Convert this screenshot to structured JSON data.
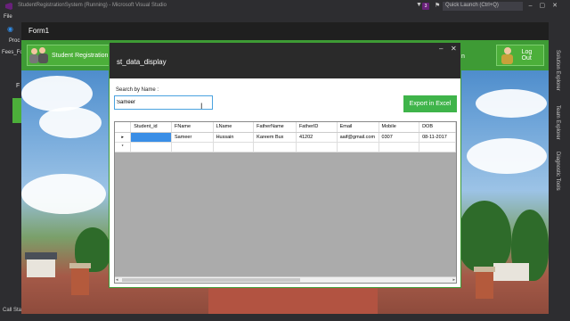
{
  "vs": {
    "title": "StudentRegistrationSystem (Running) - Microsoft Visual Studio",
    "notification_count": "3",
    "quick_launch": "Quick Launch (Ctrl+Q)",
    "menu_file": "File",
    "proc_label": "Proc",
    "fees_tab": "Fees_Fo",
    "side_letter": "F",
    "call_stack": "Call Sta",
    "right_tabs": [
      "Solution Explorer",
      "Team Explorer",
      "Diagnostic Tools"
    ]
  },
  "form1": {
    "title": "Form1",
    "student_registration_label": "Student Registration",
    "logout_label": "Log Out"
  },
  "dialog": {
    "title": "st_data_display",
    "partial_right_text": "n",
    "search_label": "Search by Name :",
    "search_value": "Sameer",
    "export_label": "Export in Excel",
    "grid": {
      "columns": [
        "Student_id",
        "FName",
        "LName",
        "FatherName",
        "FatherID",
        "Email",
        "Mobile",
        "DOB"
      ],
      "rows": [
        [
          "",
          "Sameer",
          "Hussain",
          "Kareem Bux",
          "41202",
          "aaif@gmail.com",
          "0307",
          "08-11-2017"
        ]
      ],
      "new_row_marker": "*",
      "current_row_marker": "▸"
    }
  },
  "colors": {
    "green": "#3e9b35",
    "button_green": "#3fb44a",
    "selection_blue": "#3a8ee6"
  }
}
